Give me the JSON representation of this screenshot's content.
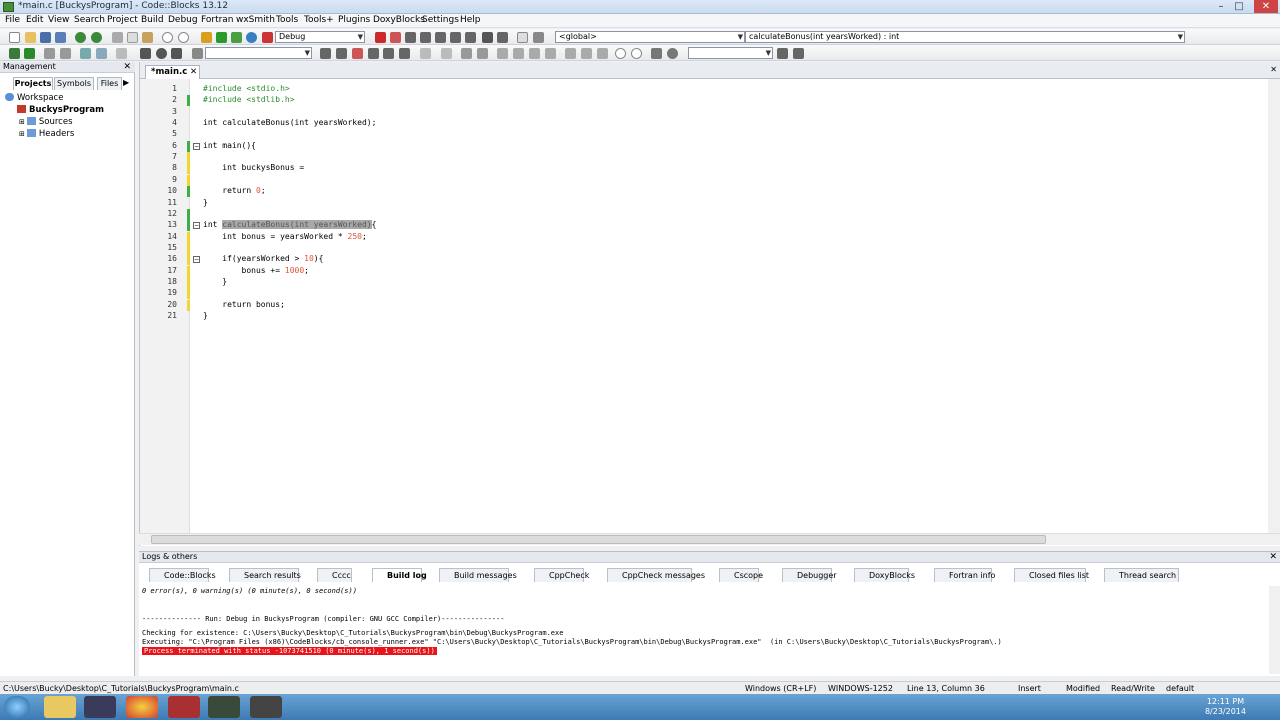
{
  "window": {
    "title": "*main.c [BuckysProgram] - Code::Blocks 13.12"
  },
  "menu": [
    "File",
    "Edit",
    "View",
    "Search",
    "Project",
    "Build",
    "Debug",
    "Fortran",
    "wxSmith",
    "Tools",
    "Tools+",
    "Plugins",
    "DoxyBlocks",
    "Settings",
    "Help"
  ],
  "toolbar": {
    "build_target": "Debug",
    "scope": "<global>",
    "function": "calculateBonus(int yearsWorked) : int"
  },
  "management": {
    "title": "Management",
    "tabs": [
      "Projects",
      "Symbols",
      "Files"
    ],
    "tree": {
      "workspace": "Workspace",
      "project": "BuckysProgram",
      "sources": "Sources",
      "headers": "Headers"
    }
  },
  "editor": {
    "tab": "*main.c",
    "lines": [
      {
        "n": "1",
        "t": "#include <stdio.h>"
      },
      {
        "n": "2",
        "t": "#include <stdlib.h>"
      },
      {
        "n": "3",
        "t": ""
      },
      {
        "n": "4",
        "t": "int calculateBonus(int yearsWorked);"
      },
      {
        "n": "5",
        "t": ""
      },
      {
        "n": "6",
        "t": "int main(){"
      },
      {
        "n": "7",
        "t": ""
      },
      {
        "n": "8",
        "t": "    int buckysBonus ="
      },
      {
        "n": "9",
        "t": ""
      },
      {
        "n": "10",
        "t": "    return 0;"
      },
      {
        "n": "11",
        "t": "}"
      },
      {
        "n": "12",
        "t": ""
      },
      {
        "n": "13",
        "t": "int calculateBonus(int yearsWorked){"
      },
      {
        "n": "14",
        "t": "    int bonus = yearsWorked * 250;"
      },
      {
        "n": "15",
        "t": ""
      },
      {
        "n": "16",
        "t": "    if(yearsWorked > 10){"
      },
      {
        "n": "17",
        "t": "        bonus += 1000;"
      },
      {
        "n": "18",
        "t": "    }"
      },
      {
        "n": "19",
        "t": ""
      },
      {
        "n": "20",
        "t": "    return bonus;"
      },
      {
        "n": "21",
        "t": "}"
      }
    ]
  },
  "logs": {
    "title": "Logs & others",
    "tabs": [
      "Code::Blocks",
      "Search results",
      "Cccc",
      "Build log",
      "Build messages",
      "CppCheck",
      "CppCheck messages",
      "Cscope",
      "Debugger",
      "DoxyBlocks",
      "Fortran info",
      "Closed files list",
      "Thread search"
    ],
    "lines": [
      "0 error(s), 0 warning(s) (0 minute(s), 0 second(s))",
      "",
      "-------------- Run: Debug in BuckysProgram (compiler: GNU GCC Compiler)---------------",
      "",
      "Checking for existence: C:\\Users\\Bucky\\Desktop\\C_Tutorials\\BuckysProgram\\bin\\Debug\\BuckysProgram.exe",
      "Executing: \"C:\\Program Files (x86)\\CodeBlocks/cb_console_runner.exe\" \"C:\\Users\\Bucky\\Desktop\\C_Tutorials\\BuckysProgram\\bin\\Debug\\BuckysProgram.exe\"  (in C:\\Users\\Bucky\\Desktop\\C_Tutorials\\BuckysProgram\\.)",
      "Process terminated with status -1073741510 (0 minute(s), 1 second(s))"
    ]
  },
  "status": {
    "path": "C:\\Users\\Bucky\\Desktop\\C_Tutorials\\BuckysProgram\\main.c",
    "eol": "Windows (CR+LF)",
    "encoding": "WINDOWS-1252",
    "position": "Line 13, Column 36",
    "mode": "Insert",
    "modified": "Modified",
    "access": "Read/Write",
    "lang": "default"
  },
  "clock": {
    "time": "12:11 PM",
    "date": "8/23/2014"
  }
}
